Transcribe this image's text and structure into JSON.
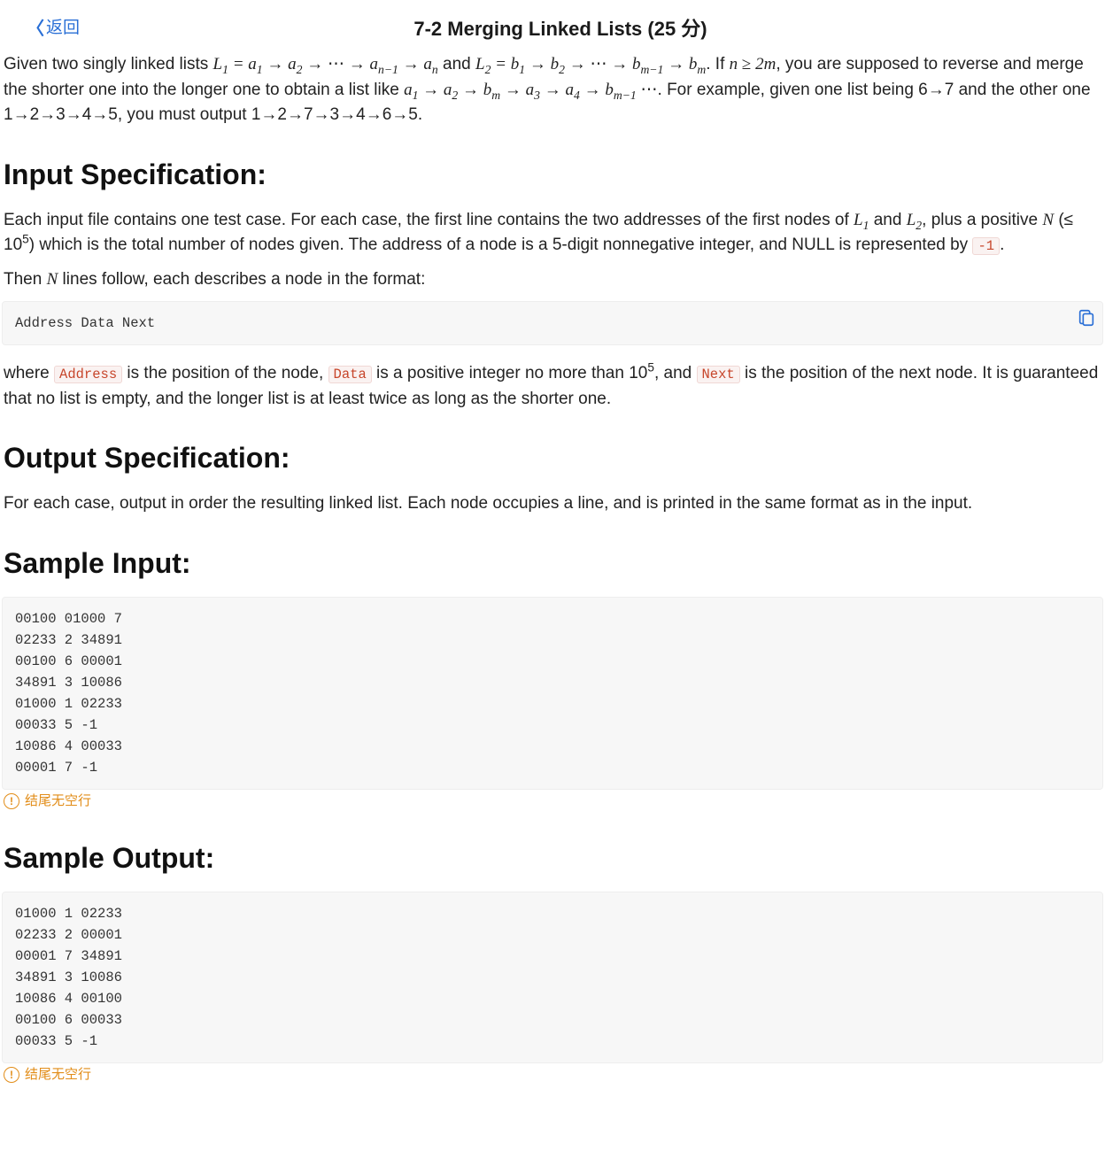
{
  "header": {
    "back_label": "返回",
    "title": "7-2 Merging Linked Lists (25 分)"
  },
  "intro": {
    "p1_a": "Given two singly linked lists ",
    "L1": "L",
    "L1s": "1",
    "eq": " = a",
    "a1s": "1",
    "arrow": " → ",
    "a2": "a",
    "a2s": "2",
    "dots": " → ⋯ → ",
    "an1": "a",
    "an1s": "n−1",
    "an": "a",
    "ans": "n",
    "and": " and ",
    "L2": "L",
    "L2s": "2",
    "eqb": " = b",
    "b1s": "1",
    "b2": "b",
    "b2s": "2",
    "bm1": "b",
    "bm1s": "m−1",
    "bm": "b",
    "bms": "m",
    "if": ". If ",
    "n": "n",
    "geq": " ≥ ",
    "twom": "2m",
    "p1_b": ", you are supposed to reverse and merge the shorter one into the longer one to obtain a list like ",
    "r_a1": "a",
    "r_a1s": "1",
    "r_a2": "a",
    "r_a2s": "2",
    "r_bm": "b",
    "r_bms": "m",
    "r_a3": "a",
    "r_a3s": "3",
    "r_a4": "a",
    "r_a4s": "4",
    "r_bm1": "b",
    "r_bm1s": "m−1",
    "trail_dots": " ⋯",
    "p1_c": ". For example, given one list being 6→7 and the other one 1→2→3→4→5, you must output 1→2→7→3→4→6→5."
  },
  "input_spec": {
    "heading": "Input Specification:",
    "p1_a": "Each input file contains one test case. For each case, the first line contains the two addresses of the first nodes of ",
    "L1": "L",
    "L1s": "1",
    "and": " and ",
    "L2": "L",
    "L2s": "2",
    "p1_b": ", plus a positive ",
    "N": "N",
    "p1_c": " (≤ 10",
    "exp5": "5",
    "p1_d": ") which is the total number of nodes given. The address of a node is a 5-digit nonnegative integer, and NULL is represented by ",
    "neg1": "-1",
    "period": ".",
    "p2_a": "Then ",
    "N2": "N",
    "p2_b": " lines follow, each describes a node in the format:",
    "code_format": "Address Data Next",
    "p3_a": "where ",
    "code_address": "Address",
    "p3_b": " is the position of the node, ",
    "code_data": "Data",
    "p3_c": " is a positive integer no more than 10",
    "exp5b": "5",
    "p3_d": ", and ",
    "code_next": "Next",
    "p3_e": " is the position of the next node. It is guaranteed that no list is empty, and the longer list is at least twice as long as the shorter one."
  },
  "output_spec": {
    "heading": "Output Specification:",
    "p1": "For each case, output in order the resulting linked list. Each node occupies a line, and is printed in the same format as in the input."
  },
  "sample_input": {
    "heading": "Sample Input:",
    "code": "00100 01000 7\n02233 2 34891\n00100 6 00001\n34891 3 10086\n01000 1 02233\n00033 5 -1\n10086 4 00033\n00001 7 -1",
    "note": "结尾无空行"
  },
  "sample_output": {
    "heading": "Sample Output:",
    "code": "01000 1 02233\n02233 2 00001\n00001 7 34891\n34891 3 10086\n10086 4 00100\n00100 6 00033\n00033 5 -1",
    "note": "结尾无空行"
  }
}
